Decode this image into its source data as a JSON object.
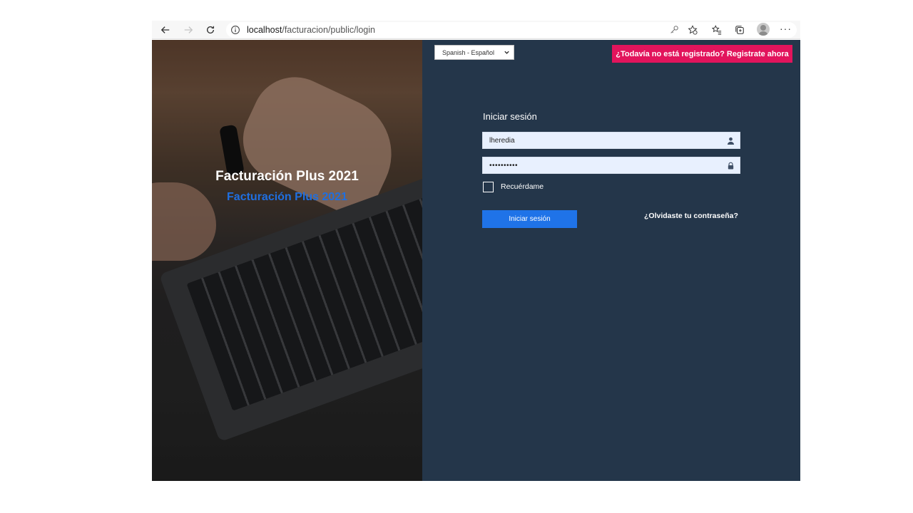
{
  "browser": {
    "url_host": "localhost",
    "url_path": "/facturacion/public/login",
    "icons": [
      "back-icon",
      "forward-icon",
      "reload-icon",
      "info-icon",
      "key-icon",
      "favorite-add-icon",
      "favorites-icon",
      "collections-icon",
      "profile-icon",
      "more-icon"
    ],
    "more_label": "···"
  },
  "hero": {
    "title": "Facturación Plus 2021",
    "subtitle": "Facturación Plus 2021",
    "subtitle_color": "#1f6fe0"
  },
  "panel": {
    "background": "#24364a",
    "language": {
      "selected": "Spanish - Español"
    },
    "register_label": "¿Todavía no está registrado? Registrate ahora",
    "register_color": "#e2145c",
    "form": {
      "title": "Iniciar sesión",
      "username_value": "lheredia",
      "password_value": "••••••••••",
      "remember_label": "Recuérdame",
      "remember_checked": false,
      "submit_label": "Iniciar sesión",
      "submit_color": "#1f73e8",
      "forgot_label": "¿Olvidaste tu contraseña?"
    }
  }
}
